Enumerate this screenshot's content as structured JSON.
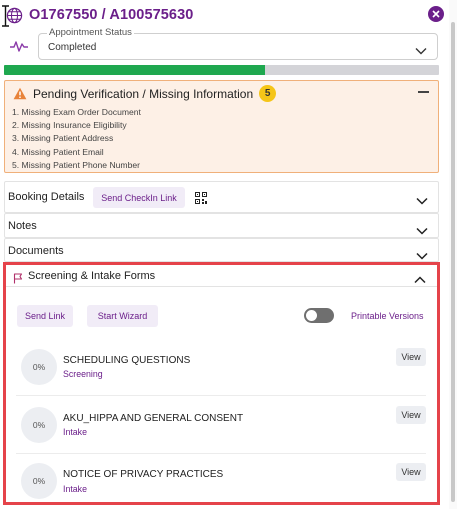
{
  "header": {
    "title": "O1767550 / A100575630",
    "icons": {
      "globe": "globe-icon",
      "close": "close-icon",
      "pulse": "pulse-icon"
    }
  },
  "appointment_status": {
    "label": "Appointment Status",
    "value": "Completed"
  },
  "progress": {
    "fraction": 0.6
  },
  "warning": {
    "title": "Pending Verification / Missing Information",
    "count": "5",
    "items": [
      "1. Missing Exam Order Document",
      "2. Missing Insurance Eligibility",
      "3. Missing Patient Address",
      "4. Missing Patient Email",
      "5. Missing Patient Phone Number"
    ]
  },
  "sections": {
    "booking": {
      "label": "Booking Details",
      "button": "Send CheckIn Link"
    },
    "notes": {
      "label": "Notes"
    },
    "documents": {
      "label": "Documents"
    }
  },
  "forms": {
    "title": "Screening & Intake Forms",
    "send_link": "Send Link",
    "start_wizard": "Start Wizard",
    "printable": "Printable Versions",
    "printable_on": false,
    "items": [
      {
        "progress": "0%",
        "name": "SCHEDULING QUESTIONS",
        "type": "Screening",
        "action": "View"
      },
      {
        "progress": "0%",
        "name": "AKU_HIPPA AND GENERAL CONSENT",
        "type": "Intake",
        "action": "View"
      },
      {
        "progress": "0%",
        "name": "NOTICE OF PRIVACY PRACTICES",
        "type": "Intake",
        "action": "View"
      }
    ]
  },
  "colors": {
    "brand": "#6b1f8a",
    "progress": "#1fa84f",
    "warning_bg": "#fdf0e6",
    "warning_border": "#f0b07a",
    "badge": "#f5c518",
    "highlight": "#e5434a"
  }
}
